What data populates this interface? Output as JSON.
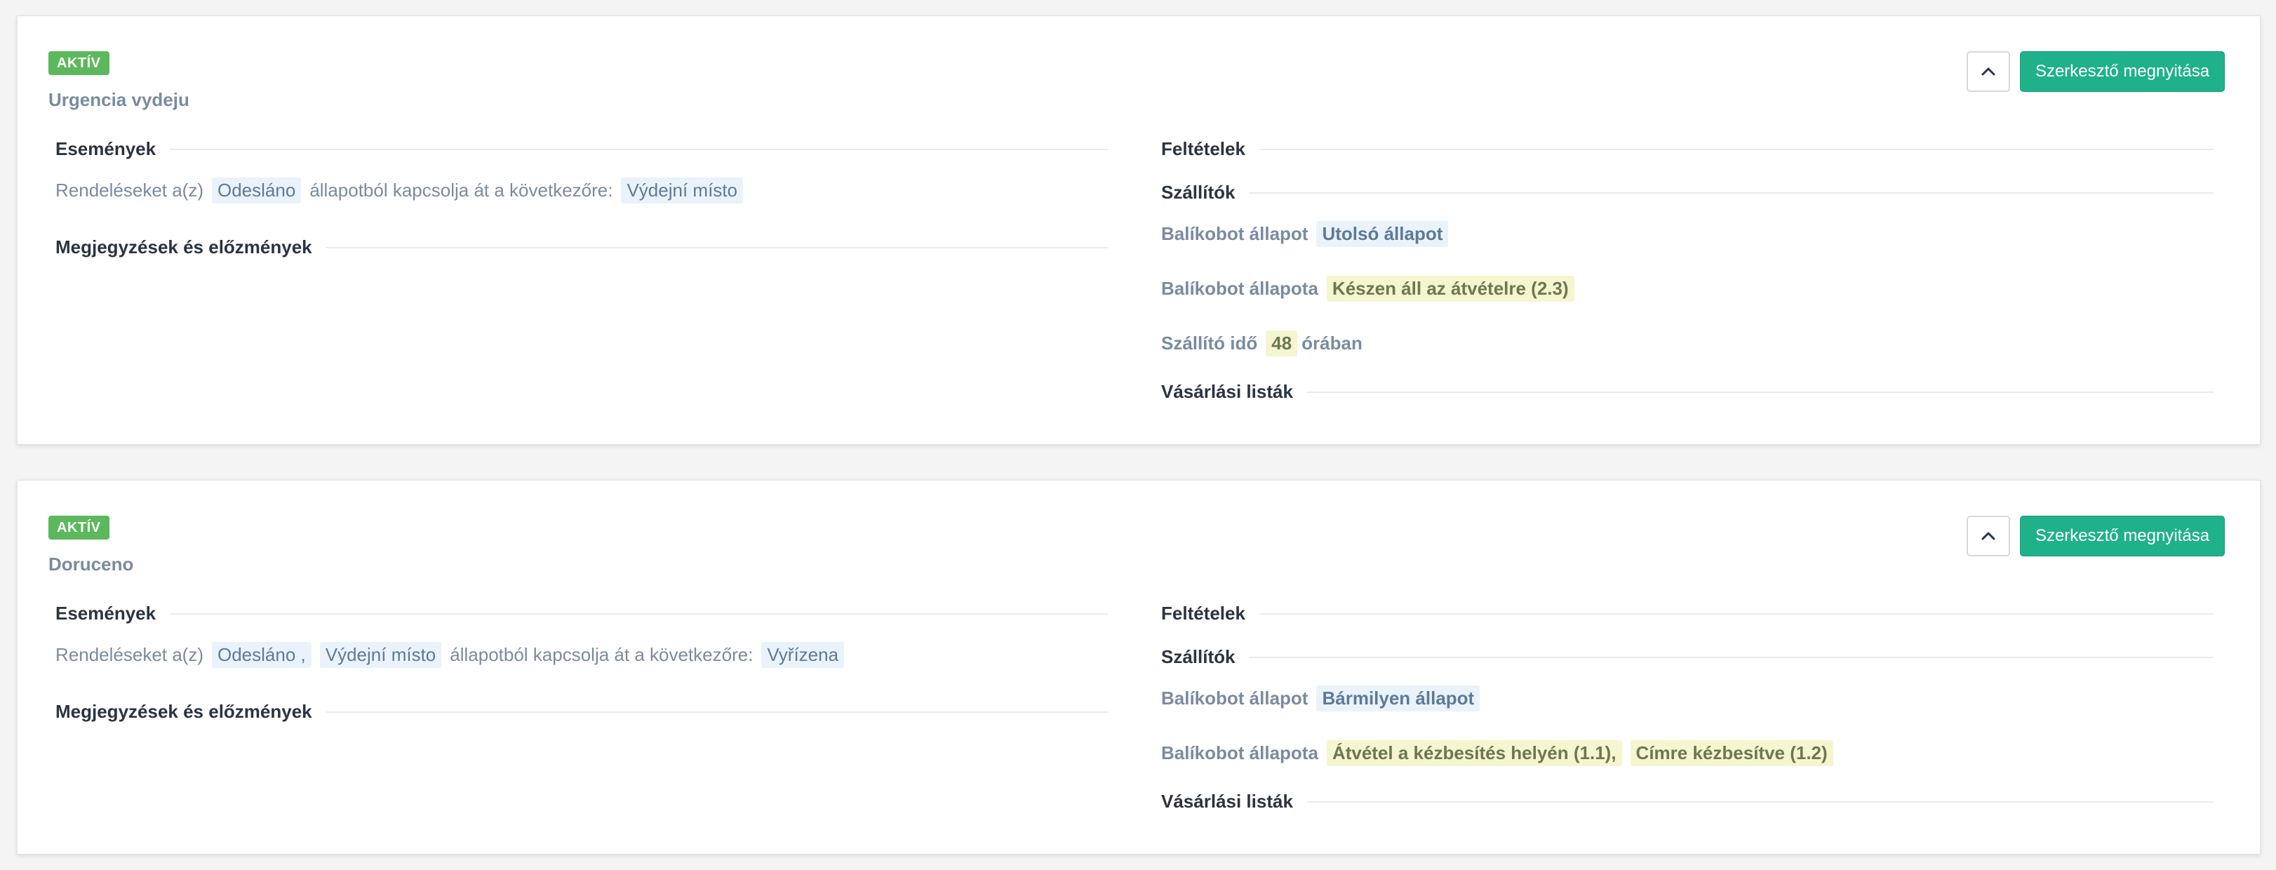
{
  "colors": {
    "badge": "#5cb85c",
    "primary_button": "#1fb18a",
    "tag_blue": "#eaf3fb",
    "tag_yellow": "#f5f6d0",
    "title": "#7a8ba0"
  },
  "icons": {
    "collapse": "chevron-up-icon"
  },
  "rules": [
    {
      "badge": "AKTÍV",
      "title": "Urgencia vydeju",
      "collapse_button": "collapse",
      "open_editor_label": "Szerkesztő megnyitása",
      "events_heading": "Események",
      "event": {
        "prefix": "Rendeléseket a(z)",
        "from_states": [
          "Odesláno"
        ],
        "middle": "állapotból kapcsolja át a következőre:",
        "to_state": "Výdejní místo"
      },
      "notes_heading": "Megjegyzések és előzmények",
      "conditions_heading": "Feltételek",
      "carriers_heading": "Szállítók",
      "conditions": [
        {
          "label": "Balíkobot állapot",
          "values": [
            "Utolsó állapot"
          ]
        },
        {
          "label": "Balíkobot állapota",
          "values": [
            "Készen áll az átvételre (2.3)"
          ]
        },
        {
          "label": "Szállító idő",
          "value": "48",
          "suffix": "órában"
        }
      ],
      "shopping_lists_heading": "Vásárlási listák"
    },
    {
      "badge": "AKTÍV",
      "title": "Doruceno",
      "collapse_button": "collapse",
      "open_editor_label": "Szerkesztő megnyitása",
      "events_heading": "Események",
      "event": {
        "prefix": "Rendeléseket a(z)",
        "from_states": [
          "Odesláno ,",
          "Výdejní místo"
        ],
        "middle": "állapotból kapcsolja át a következőre:",
        "to_state": "Vyřízena"
      },
      "notes_heading": "Megjegyzések és előzmények",
      "conditions_heading": "Feltételek",
      "carriers_heading": "Szállítók",
      "conditions": [
        {
          "label": "Balíkobot állapot",
          "values": [
            "Bármilyen állapot"
          ]
        },
        {
          "label": "Balíkobot állapota",
          "values": [
            "Átvétel a kézbesítés helyén (1.1),",
            "Címre kézbesítve (1.2)"
          ]
        }
      ],
      "shopping_lists_heading": "Vásárlási listák"
    }
  ]
}
